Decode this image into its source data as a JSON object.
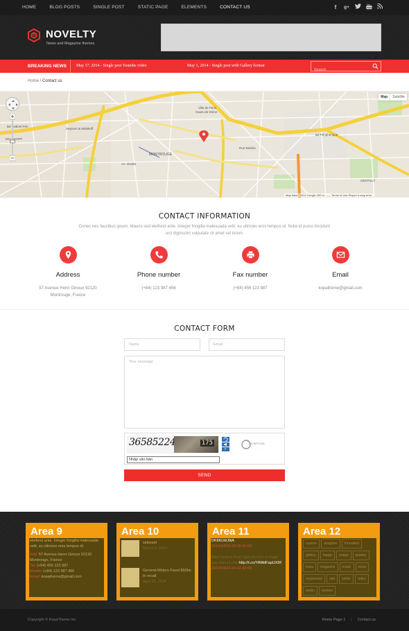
{
  "topnav": {
    "items": [
      "HOME",
      "BLOG POSTS",
      "SINGLE POST",
      "STATIC PAGE",
      "ELEMENTS",
      "CONTACT US"
    ],
    "active": "CONTACT US",
    "social": [
      "f",
      "g+",
      "t",
      "yt",
      "rss"
    ]
  },
  "header": {
    "logo": "NOVELTY",
    "tagline": "News and Magazine themes"
  },
  "breaking": {
    "label": "BREAKING NEWS",
    "news": [
      "May 17, 2014 - Single post Youtube video",
      "May 1, 2014 - Single post with Gallery format"
    ],
    "search_placeholder": "Search"
  },
  "breadcrumb": {
    "home": "Home",
    "separator": " / ",
    "current": "Contact us"
  },
  "map": {
    "type_map": "Map",
    "type_satellite": "Satellite",
    "footer": "Map data ©2014 Google   200 m ——   Terms of Use   Report a map error",
    "labels": [
      "Bd Gabriel Péri",
      "MALAKOFF",
      "MONTROUGE",
      "Rue Barbès",
      "Bd Périphérique",
      "Villa de Paris Hauts-de-Seine",
      "GENTILLY",
      "Av. Verdier",
      "Sepours & Malakoff"
    ]
  },
  "contact_info": {
    "title": "CONTACT INFORMATION",
    "description": "Donec nec faucibus ipsum. Mauris sed eleifend ante. Integer fringilla malesuada velit, eu ultricies eros tempus id. Nulla id purus tincidunt orci dignissim vulputate sit amet vel lorem.",
    "items": [
      {
        "icon": "map-marker-icon",
        "label": "Address",
        "value": "57 Avenue Henri Ginoux 92120 Montrouge, France"
      },
      {
        "icon": "phone-icon",
        "label": "Phone number",
        "value": "(+84) 123 987 456"
      },
      {
        "icon": "printer-icon",
        "label": "Fax number",
        "value": "(+84) 456 123 987"
      },
      {
        "icon": "envelope-icon",
        "label": "Email",
        "value": "kopatheme@gmail.com"
      }
    ]
  },
  "contact_form": {
    "title": "CONTACT FORM",
    "name_placeholder": "Name",
    "email_placeholder": "Email",
    "message_placeholder": "Your message",
    "captcha_text": "36585224",
    "captcha_photo_text": "175",
    "captcha_input_placeholder": "Nhập văn bản",
    "captcha_logo": "reCAPTCHA",
    "send_label": "SEND"
  },
  "footer": {
    "areas": [
      {
        "title": "Area 9",
        "text": "eleifend ante. Integer fringilla malesuada velit, eu ultricies eros tempus id.",
        "add_label": "Add:",
        "add": " 57 Avenue Henri Ginoux 92120 Montrouge, France",
        "tel_label": "Tel:",
        "tel": " (+84) 456 123 987",
        "mobile_label": "Mobile:",
        "mobile": " (+84) 123 987 456",
        "email_label": "Email:",
        "email": " kopatheme@gmail.com"
      },
      {
        "title": "Area 10",
        "posts": [
          {
            "title": "sekwaid",
            "date": "March 2, 2014"
          },
          {
            "title": "General Motors Fixed $50bn In recall",
            "date": "April 16, 2014"
          }
        ]
      },
      {
        "title": "Area 11",
        "handle": "DK6KLWJ9iA",
        "date1": "2014/04/15 02:25:00:00",
        "line2": "Add Custom Post Type Archive to Page nav-menus.php ",
        "link2": "http://t.co/YAMdFapUX9F",
        "date2": "2014/03/24 06:42:43:00"
      },
      {
        "title": "Area 12",
        "tags": [
          "custom",
          "daughter",
          "formatted",
          "gallery",
          "happy",
          "image",
          "jewelry",
          "kopa",
          "magazine",
          "music",
          "news",
          "responsive",
          "slot",
          "solids",
          "video",
          "webin",
          "women"
        ]
      }
    ]
  },
  "bottom": {
    "copyright": "Copyright © KopaTheme Inc.",
    "links": [
      "Home Page 1",
      "Contact us"
    ]
  },
  "colors": {
    "accent": "#ee3030",
    "dark": "#1c1c1c",
    "area_orange": "#f39c12",
    "area_box": "#58470f"
  }
}
